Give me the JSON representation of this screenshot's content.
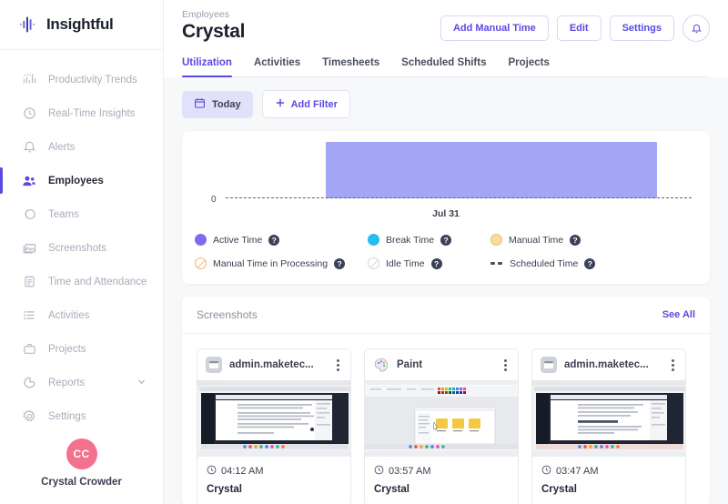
{
  "brand": {
    "name": "Insightful",
    "accent": "#5a4ae3",
    "logo_icon": "insightful-bars-logo"
  },
  "sidebar": {
    "items": [
      {
        "label": "Productivity Trends",
        "icon": "chart-trend-icon",
        "active": false
      },
      {
        "label": "Real-Time Insights",
        "icon": "clock-refresh-icon",
        "active": false
      },
      {
        "label": "Alerts",
        "icon": "bell-icon",
        "active": false
      },
      {
        "label": "Employees",
        "icon": "users-icon",
        "active": true
      },
      {
        "label": "Teams",
        "icon": "circles-icon",
        "active": false
      },
      {
        "label": "Screenshots",
        "icon": "image-icon",
        "active": false
      },
      {
        "label": "Time and Attendance",
        "icon": "clipboard-icon",
        "active": false
      },
      {
        "label": "Activities",
        "icon": "list-icon",
        "active": false
      },
      {
        "label": "Projects",
        "icon": "briefcase-icon",
        "active": false
      },
      {
        "label": "Reports",
        "icon": "pie-chart-icon",
        "active": false,
        "expandable": true,
        "chevron": "chevron-down-icon"
      },
      {
        "label": "Settings",
        "icon": "gear-icon",
        "active": false
      }
    ],
    "profile": {
      "initials": "CC",
      "name": "Crystal Crowder",
      "avatar_color": "#f4708f"
    }
  },
  "header": {
    "breadcrumb": "Employees",
    "title": "Crystal",
    "actions": [
      {
        "label": "Add Manual Time",
        "name": "add-manual-time-button"
      },
      {
        "label": "Edit",
        "name": "edit-button"
      },
      {
        "label": "Settings",
        "name": "settings-button"
      }
    ],
    "notification_icon": "bell-icon",
    "tabs": [
      {
        "label": "Utilization",
        "active": true
      },
      {
        "label": "Activities",
        "active": false
      },
      {
        "label": "Timesheets",
        "active": false
      },
      {
        "label": "Scheduled Shifts",
        "active": false
      },
      {
        "label": "Projects",
        "active": false
      }
    ]
  },
  "filters": {
    "date_chip": {
      "label": "Today",
      "icon": "calendar-icon"
    },
    "add_filter": {
      "label": "Add Filter",
      "icon": "plus-icon"
    }
  },
  "chart_data": {
    "type": "bar",
    "title": "",
    "categories": [
      "Jul 31"
    ],
    "series": [
      {
        "name": "Active Time",
        "values": [
          1
        ]
      }
    ],
    "values": [
      1
    ],
    "xlabel": "",
    "ylabel": "",
    "ytick_labels": [
      "0"
    ],
    "ylim": [
      0,
      1
    ],
    "grid": false,
    "baseline_style": "dashed",
    "bar_color": "#a5a5f5",
    "bar_left_pct": 26,
    "bar_width_pct": 66,
    "legend_position": "below",
    "legend": [
      {
        "label": "Active Time",
        "marker": "dot",
        "color": "#7b6cf0",
        "help": true
      },
      {
        "label": "Break Time",
        "marker": "dot",
        "color": "#25bdee",
        "help": true
      },
      {
        "label": "Manual Time",
        "marker": "dot",
        "color": "#f7dd9a",
        "help": true
      },
      {
        "label": "Manual Time in Processing",
        "marker": "hatch",
        "color": "#e8b878",
        "help": true
      },
      {
        "label": "Idle Time",
        "marker": "hatch-grey",
        "color": "#d3d6de",
        "help": true
      },
      {
        "label": "Scheduled Time",
        "marker": "dashed-line",
        "color": "#4a4f60",
        "help": true
      }
    ],
    "help_glyph": "?"
  },
  "screenshots": {
    "section_title": "Screenshots",
    "see_all_label": "See All",
    "items": [
      {
        "app": "admin.maketec...",
        "app_icon": "browser-window-icon",
        "time": "04:12 AM",
        "user": "Crystal",
        "clock_icon": "clock-icon",
        "menu_icon": "kebab-menu-icon",
        "thumb": "document-editor"
      },
      {
        "app": "Paint",
        "app_icon": "paint-palette-icon",
        "time": "03:57 AM",
        "user": "Crystal",
        "clock_icon": "clock-icon",
        "menu_icon": "kebab-menu-icon",
        "thumb": "paint-canvas"
      },
      {
        "app": "admin.maketec...",
        "app_icon": "browser-window-icon",
        "time": "03:47 AM",
        "user": "Crystal",
        "clock_icon": "clock-icon",
        "menu_icon": "kebab-menu-icon",
        "thumb": "document-editor-2"
      }
    ]
  }
}
